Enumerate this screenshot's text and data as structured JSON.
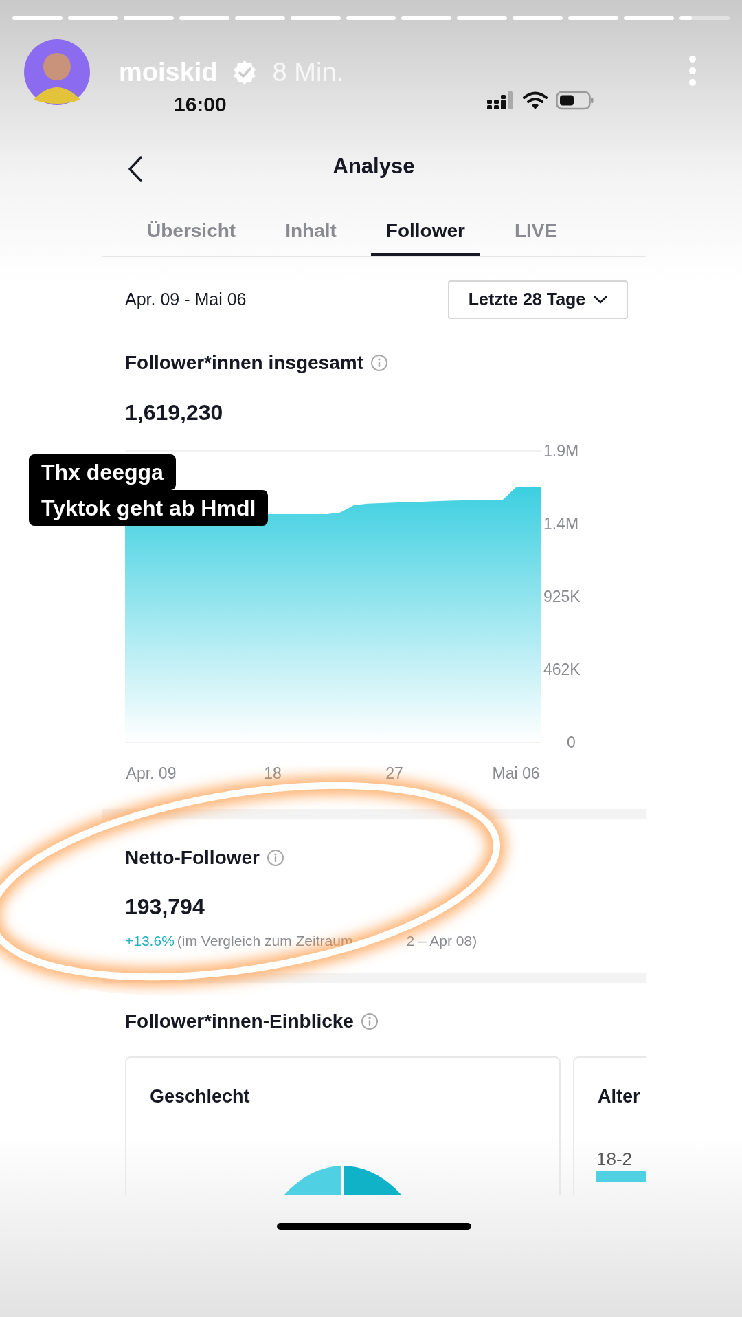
{
  "story_progress": [
    {
      "level": 1
    },
    {
      "level": 1
    },
    {
      "level": 1
    },
    {
      "level": 1
    },
    {
      "level": 1
    },
    {
      "level": 1
    },
    {
      "level": 1
    },
    {
      "level": 1
    },
    {
      "level": 1
    },
    {
      "level": 1
    },
    {
      "level": 1
    },
    {
      "level": 1
    },
    {
      "level": 0.25
    }
  ],
  "story_header": {
    "username": "moiskid",
    "verified": true,
    "time": "8 Min."
  },
  "status_bar": {
    "time": "16:00"
  },
  "app_header": {
    "title": "Analyse"
  },
  "tabs": [
    {
      "label": "Übersicht",
      "selected": false
    },
    {
      "label": "Inhalt",
      "selected": false
    },
    {
      "label": "Follower",
      "selected": true
    },
    {
      "label": "LIVE",
      "selected": false
    }
  ],
  "date_range": {
    "label": "Apr. 09 - Mai 06",
    "dropdown": "Letzte 28 Tage"
  },
  "total_followers": {
    "title": "Follower*innen insgesamt",
    "value": "1,619,230",
    "chart_data": {
      "type": "area",
      "categories": [
        "Apr. 09",
        null,
        null,
        null,
        null,
        null,
        null,
        null,
        null,
        "18",
        null,
        null,
        null,
        null,
        null,
        null,
        null,
        null,
        "27",
        null,
        null,
        null,
        null,
        null,
        null,
        null,
        null,
        "Mai 06"
      ],
      "series": [
        {
          "color": "#3ccfe0",
          "values": [
            null,
            null,
            null,
            null,
            null,
            null,
            null,
            null,
            null,
            null,
            1449000,
            1449000,
            1449000,
            1449000,
            1460000,
            1505000,
            1515000,
            1518000,
            1522000,
            1525000,
            1527000,
            1530000,
            1534000,
            1536000,
            1536000,
            1536000,
            1538000,
            1619000
          ]
        }
      ],
      "ylim": [
        0,
        1850000
      ],
      "yticks": [
        {
          "value": 0,
          "label": "0"
        },
        {
          "value": 462500,
          "label": "462K"
        },
        {
          "value": 925000,
          "label": "925K"
        },
        {
          "value": 1387500,
          "label": "1.4M"
        },
        {
          "value": 1850000,
          "label": "1.9M"
        }
      ]
    }
  },
  "sticker": [
    "Thx deegga",
    "Tyktok geht ab Hmdl"
  ],
  "net_followers": {
    "title": "Netto-Follower",
    "value": "193,794",
    "change": "+13.6%",
    "comparison_start": "(im Vergleich zum Zeitraum",
    "comparison_end": "2 – Apr 08)"
  },
  "insights": {
    "title": "Follower*innen-Einblicke",
    "cards": [
      {
        "kind": "gender",
        "title": "Geschlecht"
      },
      {
        "kind": "age",
        "title": "Alter",
        "label": "18-2"
      }
    ]
  }
}
